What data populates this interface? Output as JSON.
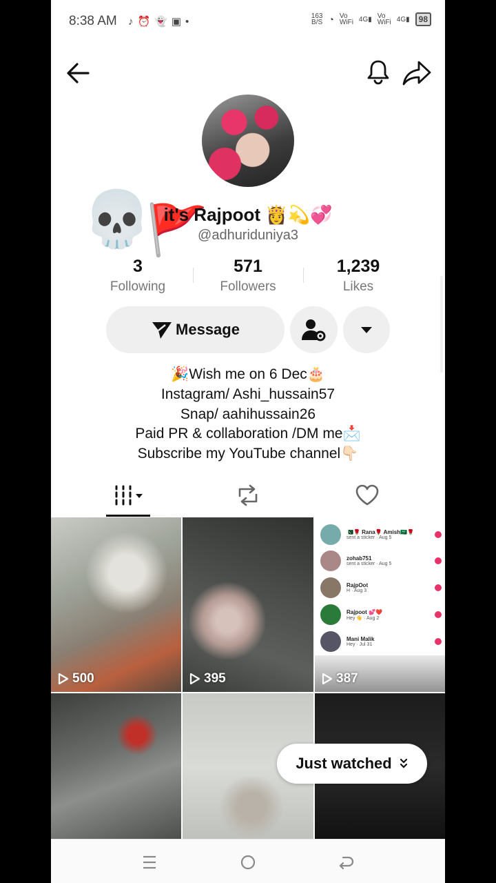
{
  "status_bar": {
    "time": "8:38 AM",
    "speed": "163\nB/S",
    "net1": "Vo\nWiFi",
    "gen1": "4G",
    "net2": "Vo\nWiFi",
    "gen2": "4G",
    "battery": "98"
  },
  "header": {
    "back_icon": "arrow-left-icon",
    "bell_icon": "bell-icon",
    "share_icon": "share-icon"
  },
  "profile": {
    "display_name": "it's Rajpoot 👸💫💞",
    "username": "@adhuriduniya3",
    "stats": [
      {
        "value": "3",
        "label": "Following"
      },
      {
        "value": "571",
        "label": "Followers"
      },
      {
        "value": "1,239",
        "label": "Likes"
      }
    ],
    "message_label": "Message",
    "bio_lines": [
      "🎉Wish me on 6 Dec🎂",
      "Instagram/ Ashi_hussain57",
      "Snap/ aahihussain26",
      "Paid PR & collaboration /DM me📩",
      "Subscribe my YouTube channel👇🏻"
    ]
  },
  "stickers": {
    "skull": "💀",
    "flag": "🚩"
  },
  "videos": [
    {
      "views": "500"
    },
    {
      "views": "395"
    },
    {
      "views": "387"
    },
    {
      "views": ""
    },
    {
      "views": ""
    },
    {
      "views": ""
    }
  ],
  "dm_preview": [
    {
      "name": "🇵🇰🌹 Rana🌹 Amish🇸🇦🌹",
      "sub": "sent a sticker · Aug 5"
    },
    {
      "name": "zohab751",
      "sub": "sent a sticker · Aug 5"
    },
    {
      "name": "RajpOot",
      "sub": "H · Aug 3"
    },
    {
      "name": "Rajpoot 💕❤️",
      "sub": "Hey 👋 · Aug 2"
    },
    {
      "name": "Mani Malik",
      "sub": "Hey · Jul 31"
    }
  ],
  "just_watched": {
    "label": "Just watched",
    "icon": "double-chevron-down-icon"
  },
  "tabs": [
    {
      "icon": "grid-icon"
    },
    {
      "icon": "repost-icon"
    },
    {
      "icon": "heart-outline-icon"
    }
  ]
}
